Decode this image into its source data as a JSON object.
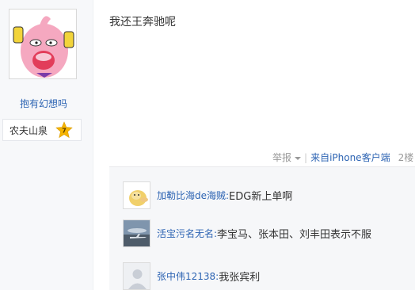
{
  "author": {
    "name": "抱有幻想吗",
    "avatar_icon": "majin-buu-avatar",
    "badge": {
      "label": "农夫山泉",
      "level": "7",
      "color": "#f5b400"
    }
  },
  "post": {
    "text": "我还王奔驰呢",
    "meta": {
      "report": "举报",
      "source": "来自iPhone客户端",
      "floor": "2楼"
    }
  },
  "comments": [
    {
      "user": "加勒比海de海贼:",
      "text": "EDG新上单啊",
      "avatar_icon": "psyduck-avatar"
    },
    {
      "user": "活宝污名无名:",
      "text": "李宝马、张本田、刘丰田表示不服",
      "avatar_icon": "airplane-photo-avatar"
    },
    {
      "user": "张中伟12138:",
      "text": "我张宾利",
      "avatar_icon": "default-user-avatar"
    }
  ]
}
